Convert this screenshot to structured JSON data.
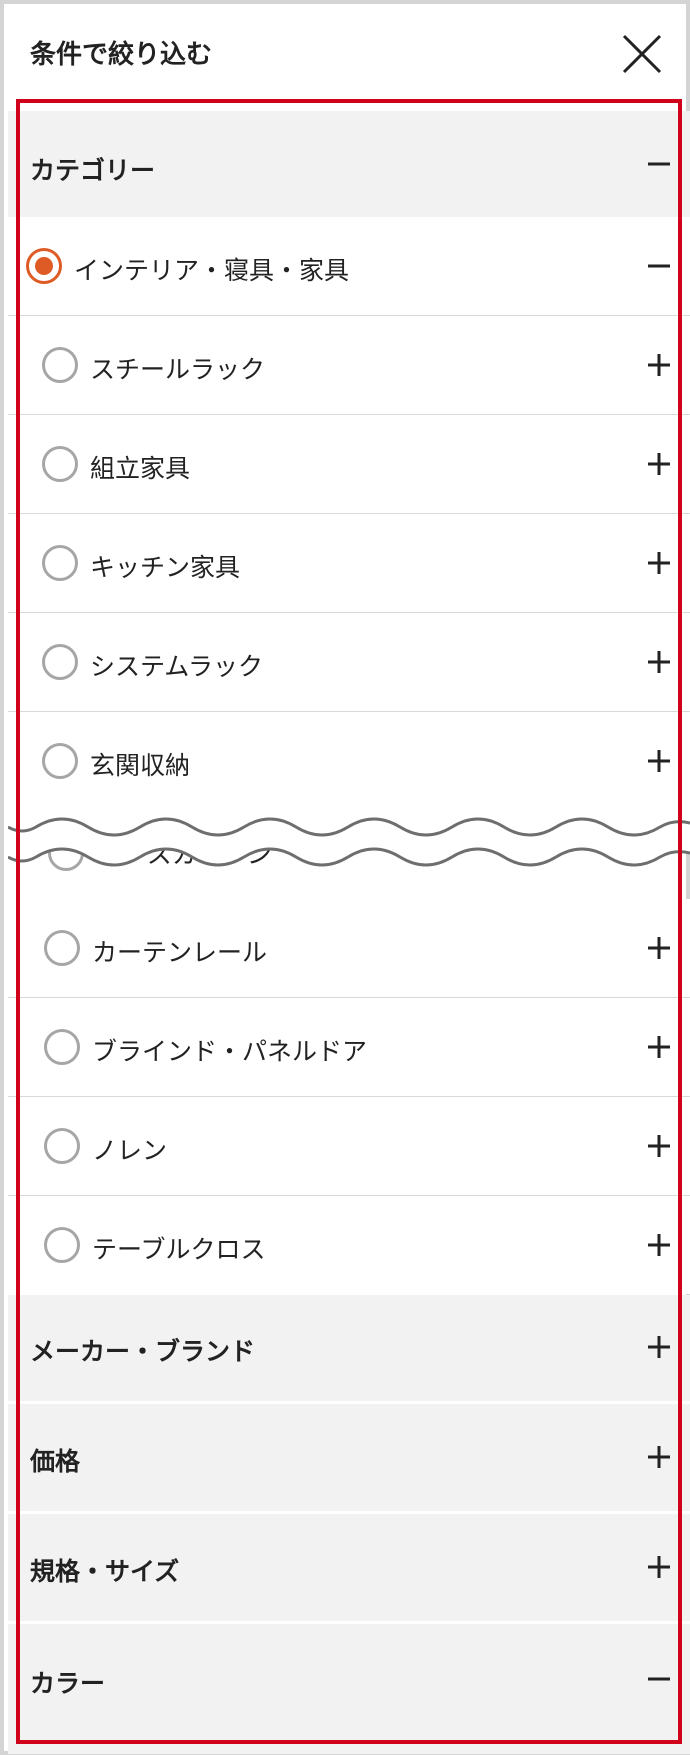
{
  "header": {
    "title": "条件で絞り込む",
    "close_icon": "close-icon"
  },
  "filters": {
    "category": {
      "label": "カテゴリー",
      "state": "expanded",
      "parent": {
        "label": "インテリア・寝具・家具",
        "selected": true,
        "state": "expanded"
      },
      "items_before_gap": [
        {
          "label": "スチールラック"
        },
        {
          "label": "組立家具"
        },
        {
          "label": "キッチン家具"
        },
        {
          "label": "システムラック"
        },
        {
          "label": "玄関収納"
        }
      ],
      "partial_item_label": "レースカーテン",
      "items_after_gap": [
        {
          "label": "カーテンレール"
        },
        {
          "label": "ブラインド・パネルドア"
        },
        {
          "label": "ノレン"
        },
        {
          "label": "テーブルクロス"
        }
      ]
    },
    "sections": [
      {
        "label": "メーカー・ブランド",
        "state": "collapsed"
      },
      {
        "label": "価格",
        "state": "collapsed"
      },
      {
        "label": "規格・サイズ",
        "state": "collapsed"
      },
      {
        "label": "カラー",
        "state": "expanded"
      }
    ]
  },
  "colors": {
    "accent": "#df5b25",
    "highlight_border": "#d0021b",
    "section_bg": "#f2f2f2",
    "divider": "#d9d9d9"
  }
}
